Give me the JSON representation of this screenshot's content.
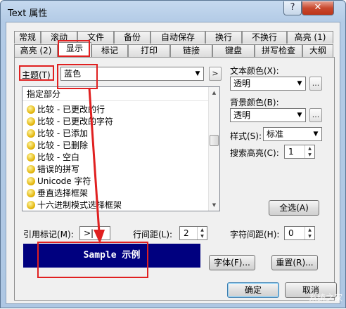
{
  "window": {
    "title": "Text 属性",
    "help_label": "?",
    "close_label": "✕"
  },
  "tabs_row1": [
    "常规",
    "滚动",
    "文件",
    "备份",
    "自动保存",
    "换行",
    "不换行",
    "高亮 (1)"
  ],
  "tabs_row2": [
    "高亮 (2)",
    "显示",
    "标记",
    "打印",
    "链接",
    "键盘",
    "拼写检查",
    "大纲"
  ],
  "active_tab": "显示",
  "theme": {
    "label": "主题(T)",
    "value": "蓝色",
    "next_button": ">"
  },
  "list": {
    "header": "指定部分",
    "items": [
      "比较 - 已更改的行",
      "比较 - 已更改的字符",
      "比较 - 已添加",
      "比较 - 已删除",
      "比较 - 空白",
      "错误的拼写",
      "Unicode 字符",
      "垂直选择框架",
      "十六进制模式选择框架"
    ]
  },
  "text_color": {
    "label": "文本颜色(X):",
    "value": "透明",
    "more": "..."
  },
  "bg_color": {
    "label": "背景颜色(B):",
    "value": "透明",
    "more": "..."
  },
  "style": {
    "label": "样式(S):",
    "value": "标准"
  },
  "search_highlight": {
    "label": "搜索高亮(C):",
    "value": "1"
  },
  "select_all_label": "全选(A)",
  "ref_mark": {
    "label": "引用标记(M):",
    "value": ">|"
  },
  "line_spacing": {
    "label": "行间距(L):",
    "value": "2"
  },
  "char_spacing": {
    "label": "字符间距(H):",
    "value": "0"
  },
  "sample_text": "Sample 示例",
  "font_button": "字体(F)...",
  "reset_button": "重置(R)...",
  "ok_button": "确定",
  "cancel_button": "取消",
  "watermark": "系统之家",
  "colors": {
    "sample_bg": "#00007f",
    "highlight_box": "#e02020",
    "close_button": "#c8492f"
  }
}
